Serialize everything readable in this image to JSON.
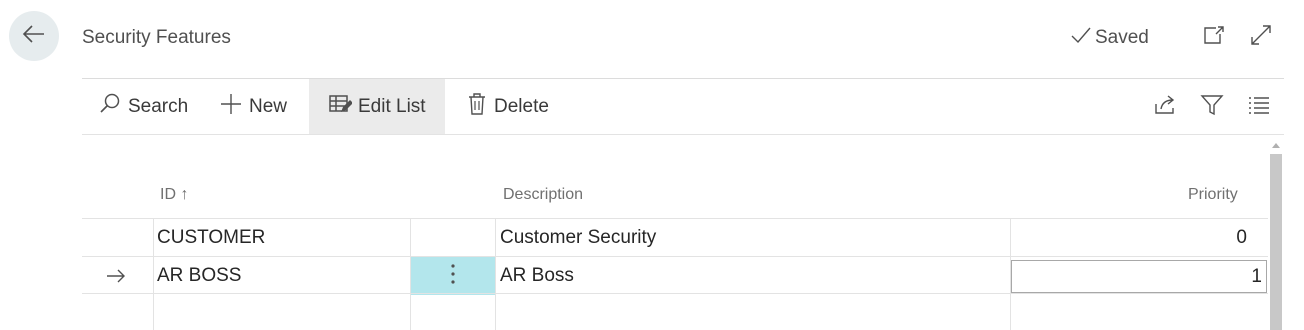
{
  "header": {
    "title": "Security Features",
    "saved_label": "Saved"
  },
  "actions": {
    "search": "Search",
    "new": "New",
    "edit_list": "Edit List",
    "delete": "Delete"
  },
  "table": {
    "columns": {
      "id": "ID",
      "id_sort": "↑",
      "description": "Description",
      "priority": "Priority"
    },
    "rows": [
      {
        "id": "CUSTOMER",
        "description": "Customer Security",
        "priority": "0"
      },
      {
        "id": "AR BOSS",
        "description": "AR Boss",
        "priority": "1"
      }
    ]
  },
  "colors": {
    "accent": "#008489",
    "selected_cell": "#b3e6ec",
    "back_button_bg": "#e6ecee"
  }
}
